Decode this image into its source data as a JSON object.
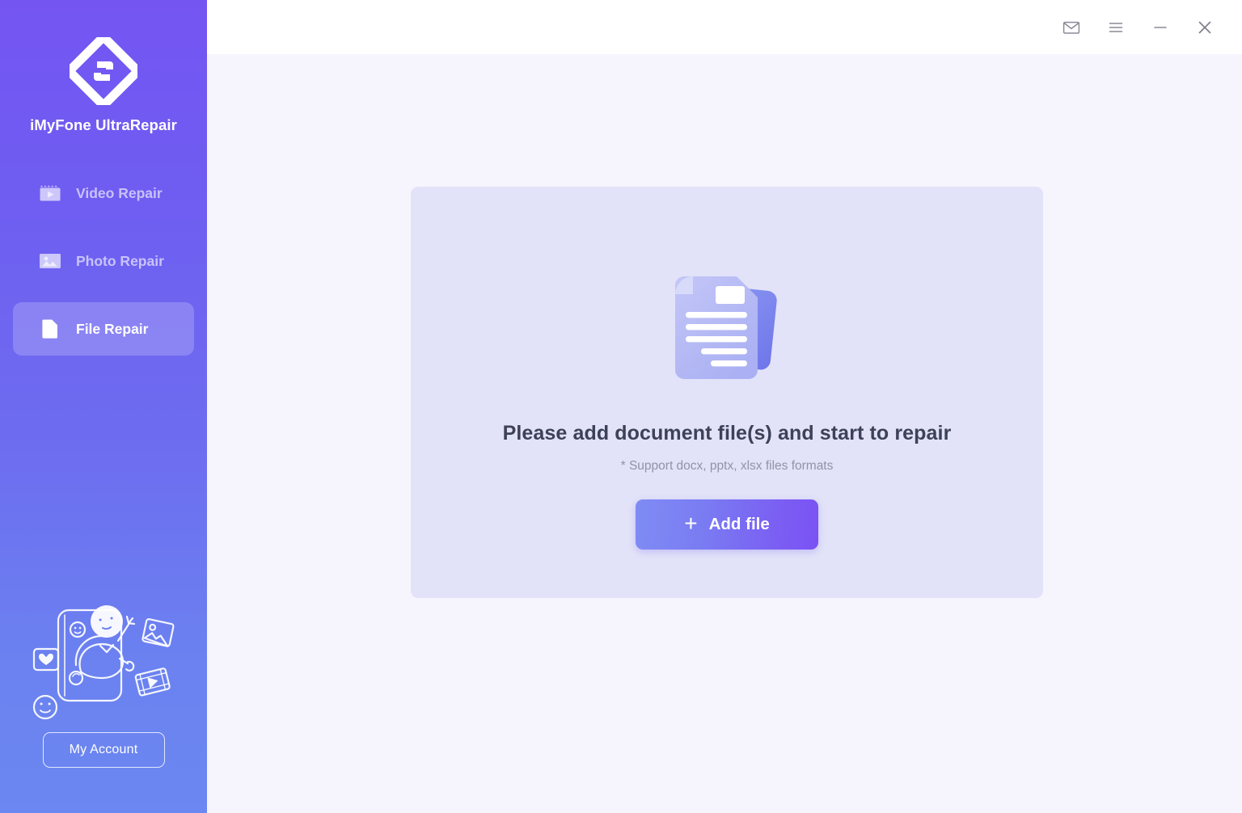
{
  "app": {
    "brand_name": "iMyFone UltraRepair",
    "logo_icon": "ultrarepair-diamond-logo",
    "accent_purple": "#7355F0",
    "accent_blue": "#6B85F0",
    "content_bg": "#F6F5FD",
    "dropzone_bg": "#E2E3F8",
    "button_gradient_from": "#7F8CF4",
    "button_gradient_to": "#7B52F4"
  },
  "titlebar": {
    "buttons": [
      {
        "name": "mail-icon",
        "label": "Feedback"
      },
      {
        "name": "menu-icon",
        "label": "Menu"
      },
      {
        "name": "minimize-icon",
        "label": "Minimize"
      },
      {
        "name": "close-icon",
        "label": "Close"
      }
    ]
  },
  "sidebar": {
    "items": [
      {
        "label": "Video Repair",
        "icon": "video-clapper-icon",
        "active": false
      },
      {
        "label": "Photo Repair",
        "icon": "photo-image-icon",
        "active": false
      },
      {
        "label": "File Repair",
        "icon": "document-file-icon",
        "active": true
      }
    ],
    "illustration_icon": "person-in-phone-illustration",
    "account_button_label": "My Account"
  },
  "main": {
    "dropzone": {
      "illustration_icon": "document-stack-illustration",
      "title": "Please add document file(s) and start to repair",
      "subtitle": "* Support docx, pptx, xlsx files formats",
      "add_button_label": "Add file",
      "add_button_plus": "+"
    }
  }
}
